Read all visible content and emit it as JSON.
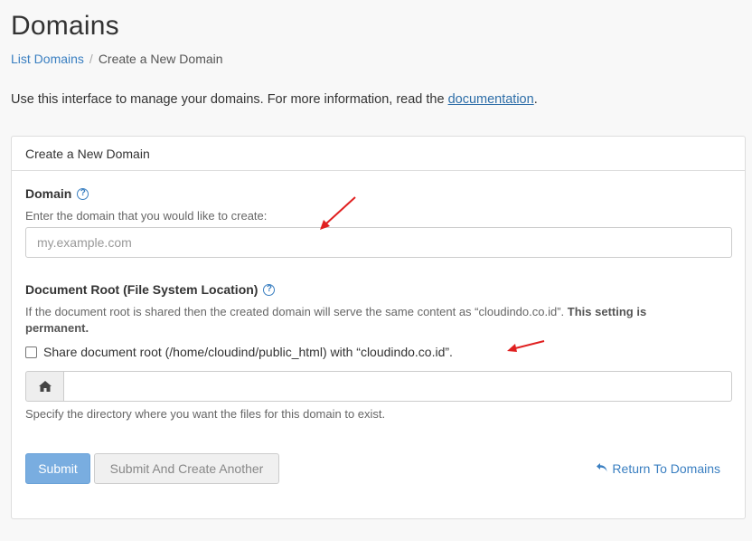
{
  "page": {
    "title": "Domains"
  },
  "breadcrumb": {
    "link_label": "List Domains",
    "separator": "/",
    "current": "Create a New Domain"
  },
  "intro": {
    "text": "Use this interface to manage your domains. For more information, read the ",
    "link_label": "documentation",
    "suffix": "."
  },
  "panel": {
    "heading": "Create a New Domain",
    "domain": {
      "label": "Domain",
      "hint": "Enter the domain that you would like to create:",
      "value": "",
      "placeholder": "my.example.com"
    },
    "document_root": {
      "label": "Document Root (File System Location)",
      "hint_text": "If the document root is shared then the created domain will serve the same content as “cloudindo.co.id”. ",
      "hint_bold": "This setting is permanent.",
      "share_checkbox_label": "Share document root (/home/cloudind/public_html) with “cloudindo.co.id”.",
      "share_checked": false,
      "path_value": "",
      "path_hint": "Specify the directory where you want the files for this domain to exist."
    },
    "actions": {
      "submit_label": "Submit",
      "submit_another_label": "Submit And Create Another",
      "return_label": "Return To Domains"
    }
  },
  "icons": {
    "help": "question-circle-icon",
    "home": "home-icon",
    "return": "undo-arrow-icon"
  },
  "colors": {
    "accent": "#3a7fc1",
    "primary_button": "#79ade0",
    "annotation_arrow": "#e02020"
  }
}
